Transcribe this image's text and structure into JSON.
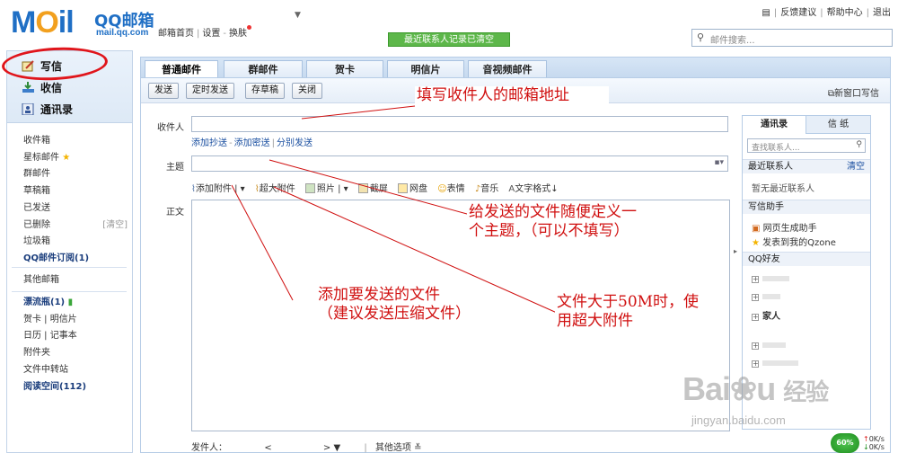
{
  "header": {
    "logo_text": "M",
    "logo_o": "O",
    "logo_tail": "il",
    "logo_cn": "QQ邮箱",
    "logo_url": "mail.qq.com",
    "nav": [
      "邮箱首页",
      "设置",
      "换肤"
    ],
    "notice": "最近联系人记录已清空",
    "top_links": [
      "反馈建议",
      "帮助中心",
      "退出"
    ],
    "search_placeholder": "邮件搜索..."
  },
  "sidebar": {
    "write": "写信",
    "inbox": "收信",
    "contacts": "通讯录",
    "folders": [
      {
        "label": "收件箱",
        "bold": false
      },
      {
        "label": "星标邮件",
        "bold": false
      },
      {
        "label": "群邮件",
        "bold": false
      },
      {
        "label": "草稿箱",
        "bold": false
      },
      {
        "label": "已发送",
        "bold": false
      },
      {
        "label": "已删除",
        "bold": false,
        "action": "[清空]"
      },
      {
        "label": "垃圾箱",
        "bold": false
      },
      {
        "label": "QQ邮件订阅(1)",
        "bold": true
      }
    ],
    "other_mailbox": "其他邮箱",
    "extras": [
      {
        "label": "漂流瓶(1)",
        "bold": true
      },
      {
        "label": "贺卡 | 明信片",
        "bold": false
      },
      {
        "label": "日历 | 记事本",
        "bold": false
      },
      {
        "label": "附件夹",
        "bold": false
      },
      {
        "label": "文件中转站",
        "bold": false
      },
      {
        "label": "阅读空间(112)",
        "bold": true
      }
    ]
  },
  "tabs": [
    "普通邮件",
    "群邮件",
    "贺卡",
    "明信片",
    "音视频邮件"
  ],
  "toolbar": {
    "send": "发送",
    "schedule": "定时发送",
    "draft": "存草稿",
    "close": "关闭",
    "new_window": "新窗口写信"
  },
  "compose": {
    "to_label": "收件人",
    "cc_links": [
      "添加抄送",
      "添加密送",
      "分别发送"
    ],
    "subject_label": "主题",
    "body_label": "正文",
    "attach_items": [
      "添加附件",
      "超大附件",
      "照片",
      "截屏",
      "网盘",
      "表情",
      "音乐",
      "文字格式↓"
    ],
    "sender_label": "发件人：",
    "other_options": "其他选项"
  },
  "contacts": {
    "tab_contacts": "通讯录",
    "tab_stationery": "信 纸",
    "search_placeholder": "查找联系人...",
    "recent_title": "最近联系人",
    "recent_clear": "清空",
    "recent_empty": "暂无最近联系人",
    "helper_title": "写信助手",
    "helper_items": [
      "网页生成助手",
      "发表到我的Qzone"
    ],
    "friends_title": "QQ好友",
    "friend_groups": [
      "家人"
    ]
  },
  "annotations": {
    "recipient": "填写收件人的邮箱地址",
    "subject": "给发送的文件随便定义一个主题，（可以不填写）",
    "attach": "添加要发送的文件（建议发送压缩文件）",
    "big": "文件大于50M时，使用超大附件"
  },
  "watermark": {
    "brand": "Bai",
    "brand2": "经验",
    "url": "jingyan.baidu.com"
  },
  "net": {
    "percent": "60%",
    "up": "0K/s",
    "down": "0K/s"
  },
  "colors": {
    "accent": "#1f6fc5",
    "notice_green": "#5db74a",
    "annotation_red": "#d01010"
  }
}
